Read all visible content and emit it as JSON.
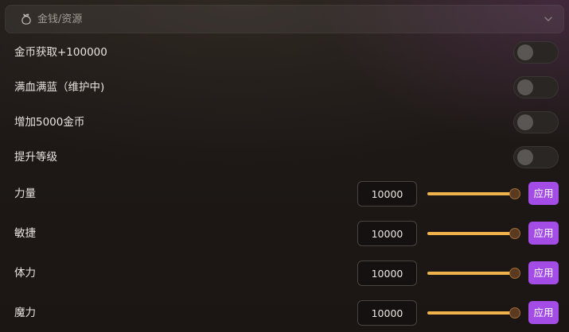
{
  "section": {
    "title": "金钱/资源",
    "icon": "money-bag-icon",
    "collapse_icon": "chevron-down-icon"
  },
  "toggles": [
    {
      "label": "金币获取+100000",
      "on": false
    },
    {
      "label": "满血满蓝（维护中)",
      "on": false
    },
    {
      "label": "增加5000金币",
      "on": false
    },
    {
      "label": "提升等级",
      "on": false
    }
  ],
  "stats": [
    {
      "label": "力量",
      "value": "10000",
      "slider_level": 1.0,
      "apply_label": "应用"
    },
    {
      "label": "敏捷",
      "value": "10000",
      "slider_level": 1.0,
      "apply_label": "应用"
    },
    {
      "label": "体力",
      "value": "10000",
      "slider_level": 1.0,
      "apply_label": "应用"
    },
    {
      "label": "魔力",
      "value": "10000",
      "slider_level": 1.0,
      "apply_label": "应用"
    }
  ],
  "colors": {
    "accent_button": "#a44de6",
    "slider_fill": "#f0b24a",
    "toggle_off": "#2a2624"
  }
}
